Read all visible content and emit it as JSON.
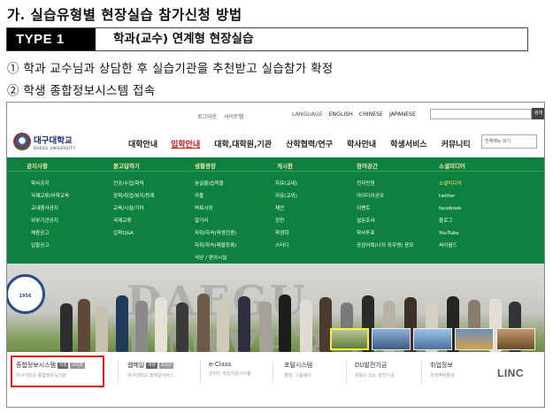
{
  "heading": "가. 실습유형별 현장실습 참가신청 방법",
  "type_label": "TYPE 1",
  "type_title": "학과(교수) 연계형 현장실습",
  "steps": [
    "① 학과 교수님과 상담한 후 실습기관을 추천받고 실습참가 확정",
    "② 학생 종합정보시스템 접속"
  ],
  "site": {
    "util_left": [
      "로그아웃",
      "사이트맵"
    ],
    "util_right": [
      "LANGUAGE",
      "ENGLISH",
      "CHINESE",
      "JAPANESE"
    ],
    "search_btn": "검색",
    "logo_kr": "대구대학교",
    "logo_en": "DAEGU UNIVERSITY",
    "nav": [
      "대학안내",
      "입학안내",
      "대학,대학원,기관",
      "산학협력/연구",
      "학사안내",
      "학생서비스",
      "커뮤니티"
    ],
    "nav_search": "전체메뉴 보기",
    "mega_heads": [
      "공지사항",
      "묻고답하기",
      "생활광장",
      "게시판",
      "참여공간",
      "소셜미디어"
    ],
    "mega_cols": [
      [
        "학사공지",
        "국제교류/어학교육",
        "교내행사공지",
        "외부기관공지",
        "채용공고",
        "입찰공고"
      ],
      [
        "전공/수업/학적",
        "장학/취업/복지/등록",
        "교육/시설/기타",
        "국제교류",
        "입학Q&A"
      ],
      [
        "분실물/습득물",
        "카풀",
        "벼룩시장",
        "알거리",
        "자취/하숙(학생전용)",
        "자취/하숙(매물등록)",
        "식당 / 편의시설"
      ],
      [
        "자유(교내)",
        "자유(교외)",
        "제안",
        "칭찬",
        "학생회",
        "스터디"
      ],
      [
        "전자민원",
        "아이디어공모",
        "이벤트",
        "설문조사",
        "학사투표",
        "공감어록(나의 좌우명) 응모"
      ],
      [
        "소셜미디어",
        "twitter",
        "facebook",
        "블로그",
        "YouTube",
        "싸이월드"
      ]
    ],
    "photo_text": "DAEGU UNIVERSITY",
    "seal_text": "1956",
    "services": [
      {
        "title": "종합정보시스템",
        "tags": [
          "학생",
          "교직원"
        ],
        "sub": "대구대학교 종합정보시스템"
      },
      {
        "title": "웹메일",
        "tags": [
          "학생",
          "교직원"
        ],
        "sub": "대구대학교 웹메일서비스"
      },
      {
        "title": "e-Class",
        "tags": [],
        "sub": "온라인 학습지원시스템"
      },
      {
        "title": "포털시스템",
        "tags": [],
        "sub": "행정, 그룹웨어"
      },
      {
        "title": "DU발전기금",
        "tags": [],
        "sub": "감동이 있는 발전기금"
      },
      {
        "title": "취업정보",
        "tags": [],
        "sub": "학생역량향상"
      }
    ],
    "linc": "LINC"
  },
  "colors": {
    "green": "#0e8040",
    "accent_red": "#c81515",
    "highlight": "#e01b1b"
  }
}
